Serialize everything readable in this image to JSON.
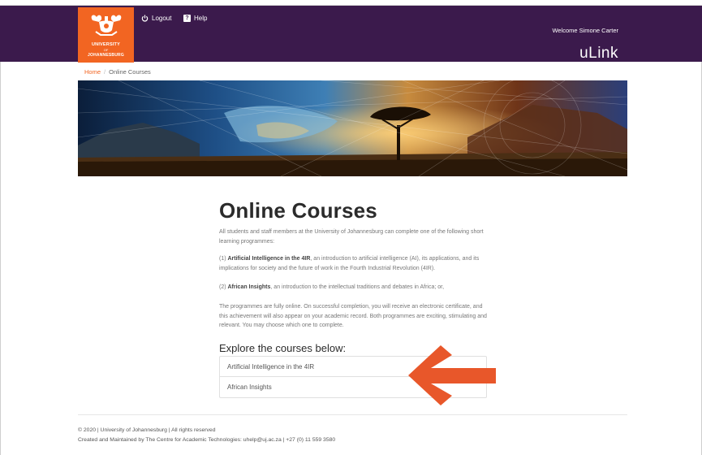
{
  "header": {
    "logo": {
      "line1": "UNIVERSITY",
      "line2": "OF",
      "line3": "JOHANNESBURG",
      "icon": "uj-emblem-icon"
    },
    "logout_label": "Logout",
    "help_label": "Help",
    "welcome_text": "Welcome Simone Carter",
    "brand": "uLink"
  },
  "breadcrumb": {
    "home": "Home",
    "separator": "/",
    "current": "Online Courses"
  },
  "main": {
    "title": "Online Courses",
    "intro": "All students and staff members at the University of Johannesburg can complete one of the following short learning programmes:",
    "item1_prefix": "(1) ",
    "item1_name": "Artificial Intelligence in the 4IR",
    "item1_desc": ", an introduction to artificial intelligence (AI), its applications, and its implications for society and the future of work in the Fourth Industrial Revolution (4IR).",
    "item2_prefix": "(2) ",
    "item2_name": "African Insights",
    "item2_desc": ", an introduction to the intellectual traditions and debates in Africa; or,",
    "closing": "The programmes are fully online. On successful completion, you will receive an electronic certificate, and this achievement will also appear on your academic record. Both programmes are exciting, stimulating and relevant. You may choose which one to complete.",
    "explore_heading": "Explore the courses below:",
    "courses": [
      "Artificial Intelligence in the 4IR",
      "African Insights"
    ]
  },
  "footer": {
    "line1": "© 2020 | University of Johannesburg | All rights reserved",
    "line2": "Created and Maintained by The Centre for Academic Technologies: uhelp@uj.ac.za | +27 (0) 11 559 3580"
  },
  "colors": {
    "header_bg": "#3b1a4c",
    "brand_orange": "#f26522",
    "arrow": "#e8572a"
  }
}
